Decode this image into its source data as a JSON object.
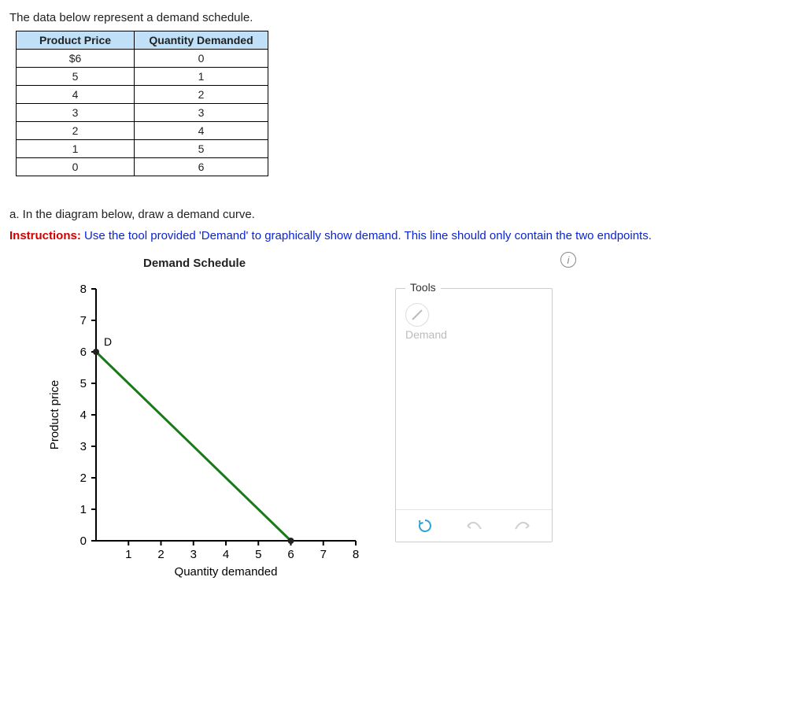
{
  "intro": "The data below represent a demand schedule.",
  "table": {
    "headers": [
      "Product Price",
      "Quantity Demanded"
    ],
    "rows": [
      [
        "$6",
        "0"
      ],
      [
        "5",
        "1"
      ],
      [
        "4",
        "2"
      ],
      [
        "3",
        "3"
      ],
      [
        "2",
        "4"
      ],
      [
        "1",
        "5"
      ],
      [
        "0",
        "6"
      ]
    ]
  },
  "partA": "a. In the diagram below, draw a demand curve.",
  "instructions": {
    "kw": "Instructions:",
    "text": " Use the tool provided 'Demand' to graphically show demand. This line should only contain the two endpoints."
  },
  "chart": {
    "title": "Demand Schedule",
    "ylabel": "Product price",
    "xlabel": "Quantity demanded",
    "series_label": "D"
  },
  "tools": {
    "legend": "Tools",
    "demand_label": "Demand"
  },
  "info_glyph": "i",
  "chart_data": {
    "type": "line",
    "title": "Demand Schedule",
    "xlabel": "Quantity demanded",
    "ylabel": "Product price",
    "xlim": [
      0,
      8
    ],
    "ylim": [
      0,
      8
    ],
    "xticks": [
      1,
      2,
      3,
      4,
      5,
      6,
      7,
      8
    ],
    "yticks": [
      0,
      1,
      2,
      3,
      4,
      5,
      6,
      7,
      8
    ],
    "series": [
      {
        "name": "D",
        "color": "#1a7a1a",
        "x": [
          0,
          6
        ],
        "y": [
          6,
          0
        ]
      }
    ],
    "table": {
      "columns": [
        "Product Price",
        "Quantity Demanded"
      ],
      "rows": [
        [
          6,
          0
        ],
        [
          5,
          1
        ],
        [
          4,
          2
        ],
        [
          3,
          3
        ],
        [
          2,
          4
        ],
        [
          1,
          5
        ],
        [
          0,
          6
        ]
      ]
    }
  }
}
